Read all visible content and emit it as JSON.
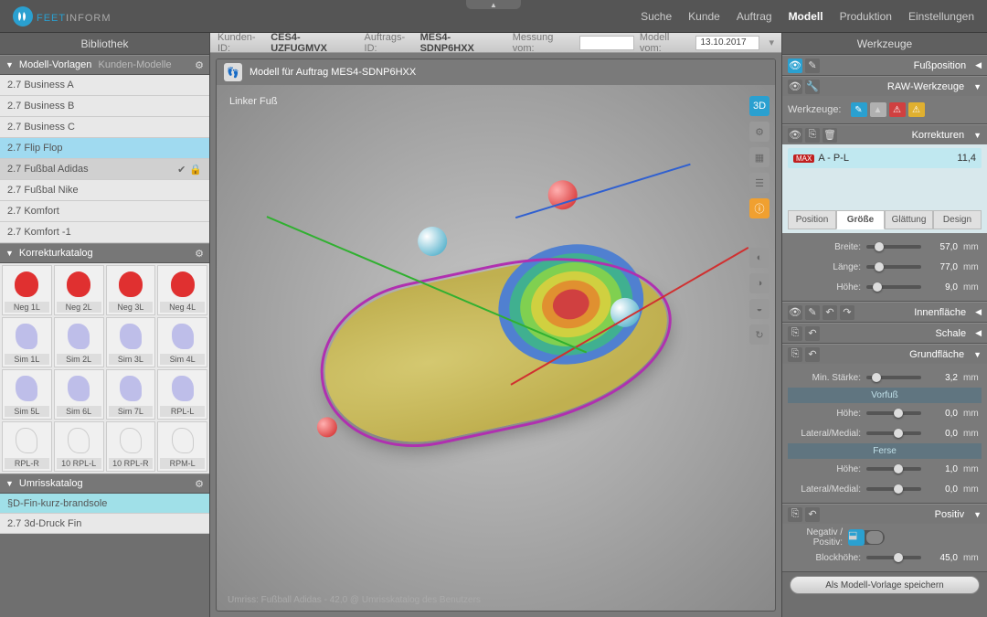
{
  "brand": {
    "feet": "FEET",
    "inform": "INFORM"
  },
  "nav": {
    "items": [
      "Suche",
      "Kunde",
      "Auftrag",
      "Modell",
      "Produktion",
      "Einstellungen"
    ],
    "active": 3
  },
  "left": {
    "title": "Bibliothek",
    "templates": {
      "label": "Modell-Vorlagen",
      "sub": "Kunden-Modelle",
      "items": [
        "2.7 Business A",
        "2.7 Business B",
        "2.7 Business C",
        "2.7 Flip Flop",
        "2.7 Fußbal Adidas",
        "2.7 Fußbal Nike",
        "2.7 Komfort",
        "2.7 Komfort -1"
      ],
      "selected": 3,
      "confirmed": 4
    },
    "corrCatalog": {
      "label": "Korrekturkatalog",
      "items": [
        "Neg 1L",
        "Neg 2L",
        "Neg 3L",
        "Neg 4L",
        "Sim 1L",
        "Sim 2L",
        "Sim 3L",
        "Sim 4L",
        "Sim 5L",
        "Sim 6L",
        "Sim 7L",
        "RPL-L",
        "RPL-R",
        "10 RPL-L",
        "10 RPL-R",
        "RPM-L"
      ]
    },
    "outlineCatalog": {
      "label": "Umrisskatalog",
      "items": [
        "§D-Fin-kurz-brandsole",
        "2.7 3d-Druck Fin"
      ]
    }
  },
  "info": {
    "kundenId_lbl": "Kunden-ID:",
    "kundenId": "CES4-UZFUGMVX",
    "auftragId_lbl": "Auftrags-ID:",
    "auftragId": "MES4-SDNP6HXX",
    "messung_lbl": "Messung vom:",
    "messung": "",
    "modellVom_lbl": "Modell vom:",
    "modellVom": "13.10.2017"
  },
  "viewport": {
    "title": "Modell für Auftrag  MES4-SDNP6HXX",
    "side": "Linker Fuß",
    "footer": "Umriss:   Fußball Adidas - 42,0 @ Umrisskatalog des Benutzers",
    "badge3d": "3D"
  },
  "right": {
    "title": "Werkzeuge",
    "fussposition": "Fußposition",
    "raw": {
      "title": "RAW-Werkzeuge",
      "label": "Werkzeuge:"
    },
    "korrekturen": {
      "title": "Korrekturen",
      "item": {
        "badge": "MAX",
        "name": "A - P-L",
        "val": "11,4"
      },
      "tabs": [
        "Position",
        "Größe",
        "Glättung",
        "Design"
      ],
      "activeTab": 1,
      "sliders": [
        {
          "lbl": "Breite:",
          "val": "57,0",
          "pos": 15
        },
        {
          "lbl": "Länge:",
          "val": "77,0",
          "pos": 15
        },
        {
          "lbl": "Höhe:",
          "val": "9,0",
          "pos": 12
        }
      ]
    },
    "innenflache": "Innenfläche",
    "schale": "Schale",
    "grundflache": {
      "title": "Grundfläche",
      "minStarke": {
        "lbl": "Min. Stärke:",
        "val": "3,2",
        "pos": 10
      },
      "vorfuss": {
        "title": "Vorfuß",
        "hohe": {
          "lbl": "Höhe:",
          "val": "0,0",
          "pos": 50
        },
        "lateral": {
          "lbl": "Lateral/Medial:",
          "val": "0,0",
          "pos": 50
        }
      },
      "ferse": {
        "title": "Ferse",
        "hohe": {
          "lbl": "Höhe:",
          "val": "1,0",
          "pos": 50
        },
        "lateral": {
          "lbl": "Lateral/Medial:",
          "val": "0,0",
          "pos": 50
        }
      }
    },
    "positiv": {
      "title": "Positiv",
      "toggle_lbl": "Negativ / Positiv:",
      "block": {
        "lbl": "Blockhöhe:",
        "val": "45,0",
        "pos": 50
      }
    },
    "save": "Als Modell-Vorlage speichern",
    "unit": "mm"
  }
}
